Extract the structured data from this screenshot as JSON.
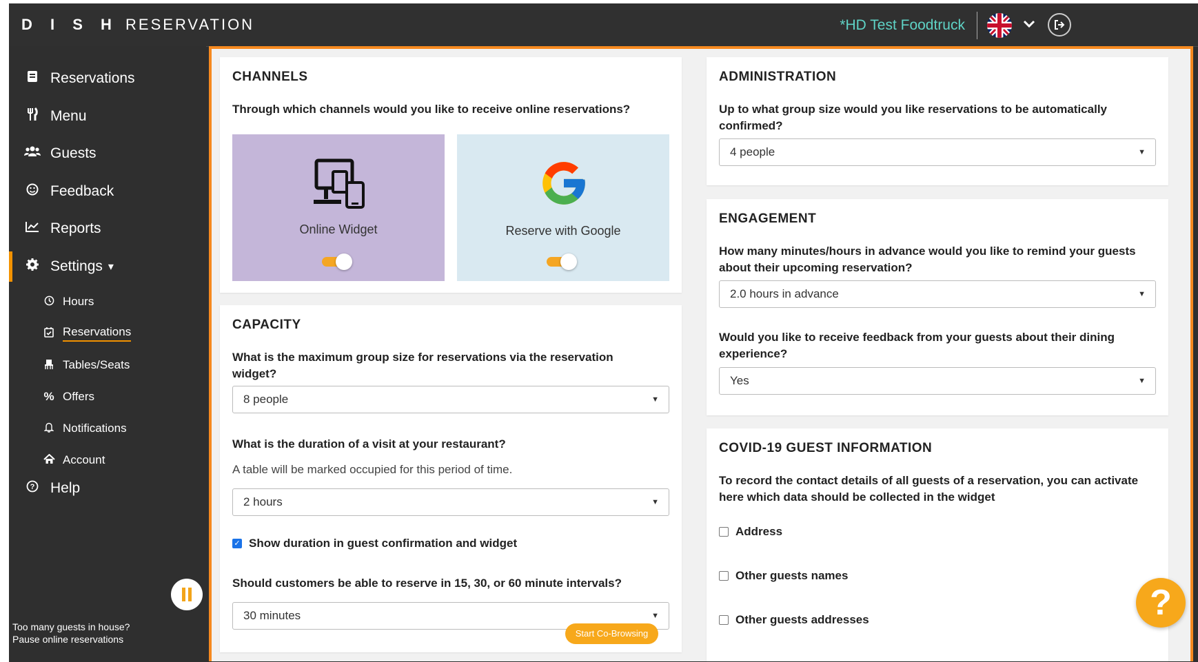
{
  "header": {
    "brand_bold": "D I S H",
    "brand_rest": "RESERVATION",
    "restaurant": "*HD Test Foodtruck",
    "language_icon": "uk-flag-icon",
    "chevron_icon": "chevron-down-icon",
    "logout_icon": "logout-icon"
  },
  "sidebar": {
    "items": [
      {
        "label": "Reservations",
        "icon": "book-icon"
      },
      {
        "label": "Menu",
        "icon": "cutlery-icon"
      },
      {
        "label": "Guests",
        "icon": "users-icon"
      },
      {
        "label": "Feedback",
        "icon": "smile-icon"
      },
      {
        "label": "Reports",
        "icon": "chart-icon"
      },
      {
        "label": "Settings",
        "icon": "gear-icon"
      },
      {
        "label": "Help",
        "icon": "help-circle-icon"
      }
    ],
    "settings_caret": "▾",
    "subitems": [
      {
        "label": "Hours",
        "icon": "clock-icon"
      },
      {
        "label": "Reservations",
        "icon": "calendar-check-icon"
      },
      {
        "label": "Tables/Seats",
        "icon": "chair-icon"
      },
      {
        "label": "Offers",
        "icon": "percent-icon"
      },
      {
        "label": "Notifications",
        "icon": "bell-icon"
      },
      {
        "label": "Account",
        "icon": "home-icon"
      }
    ],
    "pause_line1": "Too many guests in house?",
    "pause_line2": "Pause online reservations"
  },
  "channels": {
    "title": "CHANNELS",
    "question": "Through which channels would you like to receive online reservations?",
    "widget_label": "Online Widget",
    "widget_enabled": true,
    "google_label": "Reserve with Google",
    "google_enabled": true
  },
  "capacity": {
    "title": "CAPACITY",
    "max_group_q": "What is the maximum group size for reservations via the reservation widget?",
    "max_group_value": "8 people",
    "duration_q": "What is the duration of a visit at your restaurant?",
    "duration_hint": "A table will be marked occupied for this period of time.",
    "duration_value": "2 hours",
    "show_duration_label": "Show duration in guest confirmation and widget",
    "show_duration_checked": true,
    "interval_q": "Should customers be able to reserve in 15, 30, or 60 minute intervals?",
    "interval_value": "30 minutes"
  },
  "administration": {
    "title": "ADMINISTRATION",
    "question": "Up to what group size would you like reservations to be automatically confirmed?",
    "value": "4 people"
  },
  "engagement": {
    "title": "ENGAGEMENT",
    "remind_q": "How many minutes/hours in advance would you like to remind your guests about their upcoming reservation?",
    "remind_value": "2.0 hours in advance",
    "feedback_q": "Would you like to receive feedback from your guests about their dining experience?",
    "feedback_value": "Yes"
  },
  "covid": {
    "title": "COVID-19 GUEST INFORMATION",
    "description": "To record the contact details of all guests of a reservation, you can activate here which data should be collected in the widget",
    "options": [
      {
        "label": "Address",
        "checked": false
      },
      {
        "label": "Other guests names",
        "checked": false
      },
      {
        "label": "Other guests addresses",
        "checked": false
      }
    ]
  },
  "overlay": {
    "cobrowse_label": "Start Co-Browsing",
    "help_glyph": "?"
  },
  "colors": {
    "accent": "#f39200",
    "sidebar_bg": "#2f2f2f",
    "restaurant_text": "#5fd3c6",
    "widget_tile": "#c4b6d9",
    "google_tile": "#d9e9f1",
    "toggle_on": "#f5a623"
  }
}
